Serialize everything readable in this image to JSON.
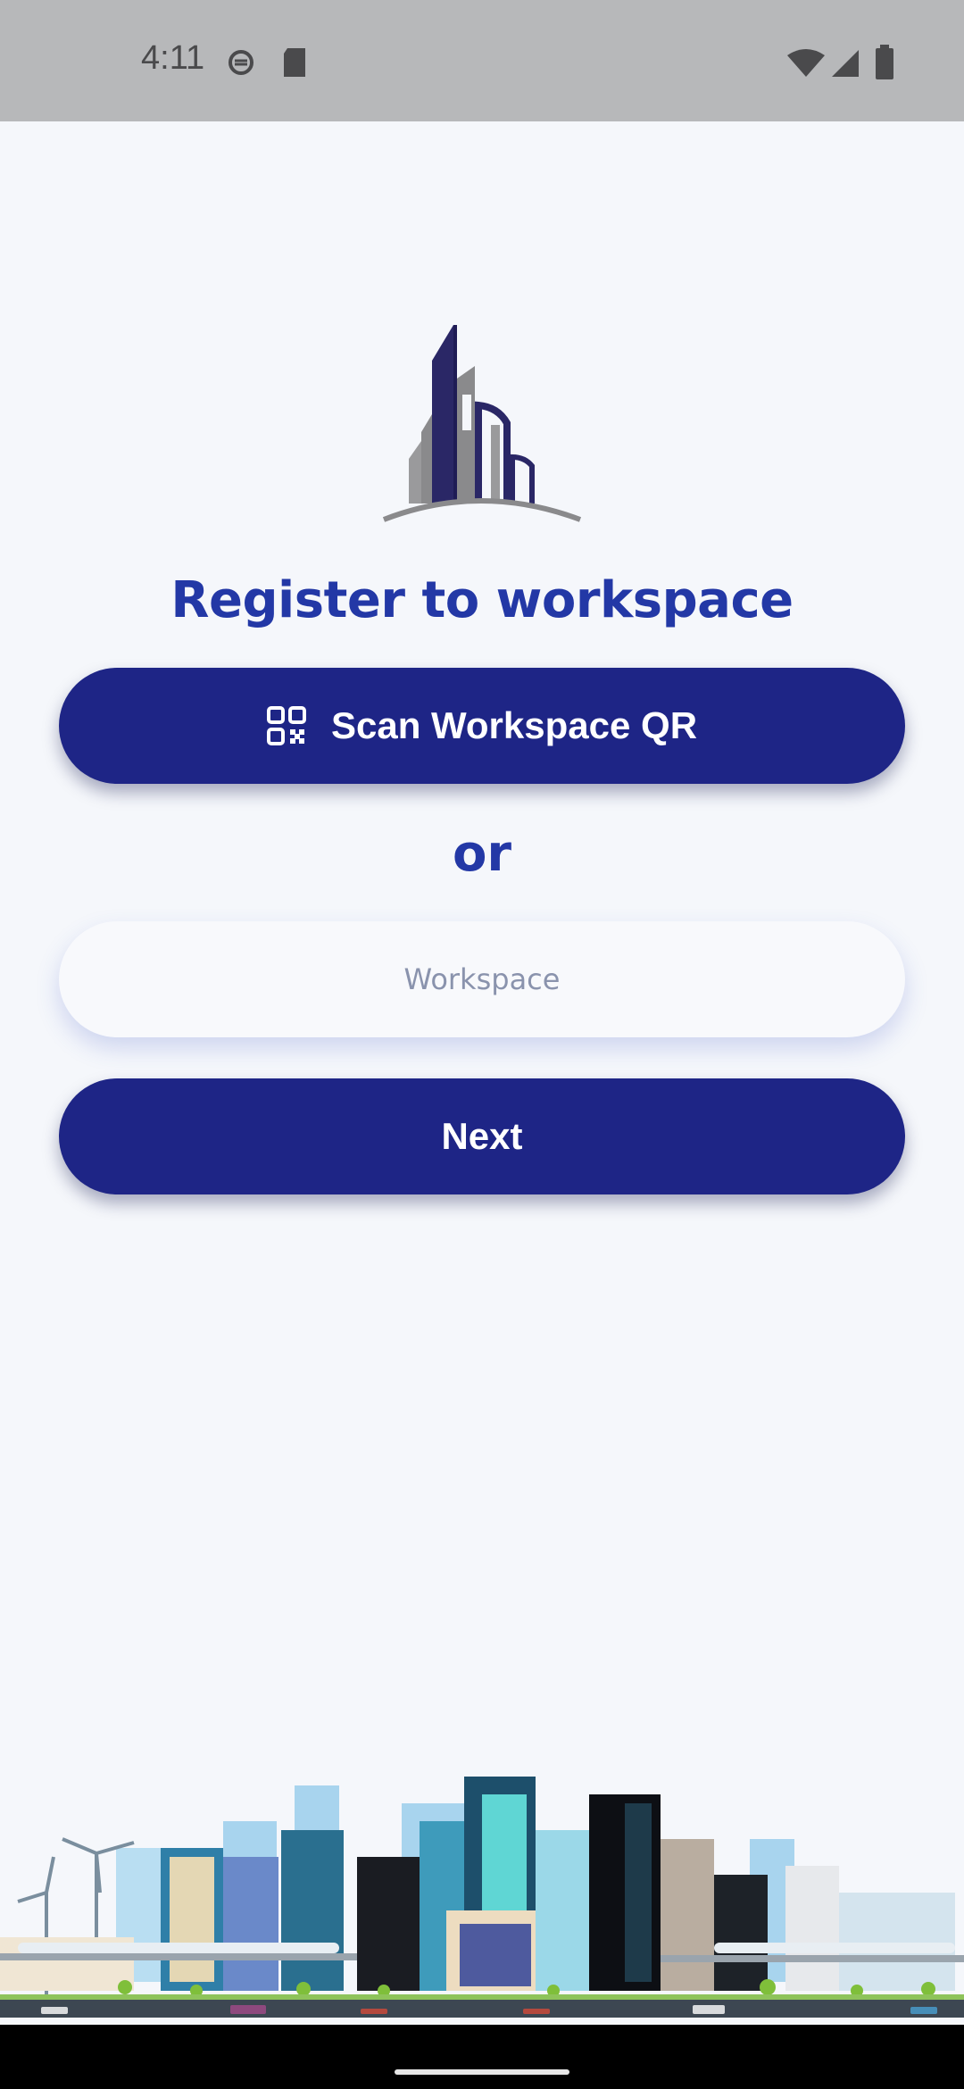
{
  "status_bar": {
    "time": "4:11",
    "icons": [
      "sync-icon",
      "sd-card-icon",
      "wifi-icon",
      "signal-icon",
      "battery-icon"
    ]
  },
  "main": {
    "title": "Register to workspace",
    "scan_button_label": "Scan Workspace QR",
    "scan_button_icon": "qr-code-icon",
    "or_label": "or",
    "workspace_placeholder": "Workspace",
    "workspace_value": "",
    "next_button_label": "Next"
  },
  "colors": {
    "accent": "#1e2586",
    "title": "#2338a6",
    "background": "#f5f7fb"
  }
}
